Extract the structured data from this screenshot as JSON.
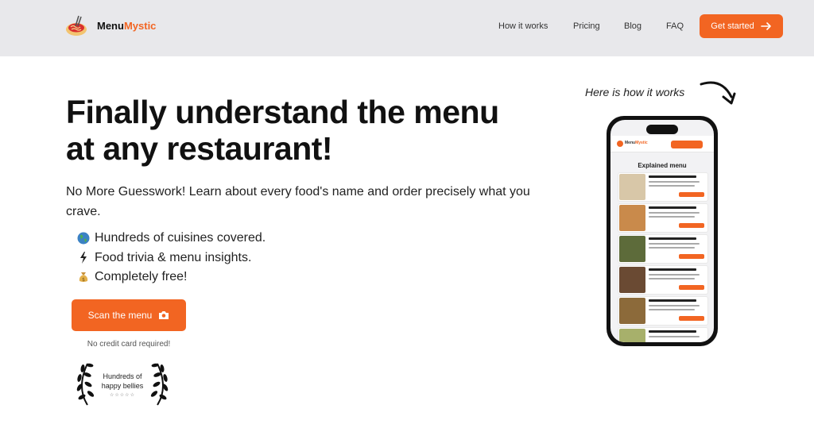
{
  "brand": {
    "name_part1": "Menu",
    "name_part2": "Mystic"
  },
  "nav": {
    "links": [
      {
        "label": "How it works"
      },
      {
        "label": "Pricing"
      },
      {
        "label": "Blog"
      },
      {
        "label": "FAQ"
      }
    ],
    "cta_label": "Get started"
  },
  "hero": {
    "headline_line1": "Finally understand the menu",
    "headline_line2": "at any restaurant!",
    "subtext": "No More Guesswork! Learn about every food's name and order precisely what you crave.",
    "features": [
      {
        "icon": "globe-icon",
        "text": "Hundreds of cuisines covered."
      },
      {
        "icon": "lightning-icon",
        "text": "Food trivia & menu insights."
      },
      {
        "icon": "money-bag-icon",
        "text": "Completely free!"
      }
    ],
    "scan_label": "Scan the menu",
    "no_credit": "No credit card required!",
    "laurel_line1": "Hundreds of",
    "laurel_line2": "happy bellies",
    "laurel_stars": "☆☆☆☆☆"
  },
  "demo": {
    "caption": "Here is how it works",
    "phone_title": "Explained menu"
  },
  "colors": {
    "accent": "#f26522",
    "nav_bg": "#e8e8eb",
    "text": "#111111"
  }
}
